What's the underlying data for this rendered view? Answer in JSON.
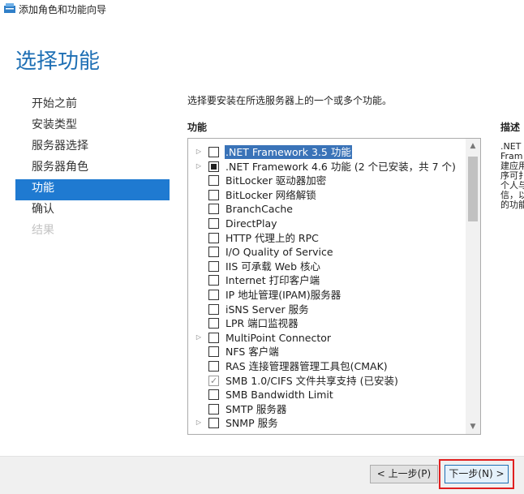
{
  "window": {
    "title": "添加角色和功能向导"
  },
  "page": {
    "title": "选择功能",
    "instruction": "选择要安装在所选服务器上的一个或多个功能。",
    "features_header": "功能",
    "description_header": "描述"
  },
  "steps": [
    {
      "label": "开始之前",
      "state": "normal"
    },
    {
      "label": "安装类型",
      "state": "normal"
    },
    {
      "label": "服务器选择",
      "state": "normal"
    },
    {
      "label": "服务器角色",
      "state": "normal"
    },
    {
      "label": "功能",
      "state": "active"
    },
    {
      "label": "确认",
      "state": "normal"
    },
    {
      "label": "结果",
      "state": "disabled"
    }
  ],
  "features": [
    {
      "label": ".NET Framework 3.5 功能",
      "expandable": true,
      "check": "none",
      "selected": true
    },
    {
      "label": ".NET Framework 4.6 功能 (2 个已安装，共 7 个)",
      "expandable": true,
      "check": "partial",
      "selected": false
    },
    {
      "label": "BitLocker 驱动器加密",
      "expandable": false,
      "check": "none",
      "selected": false
    },
    {
      "label": "BitLocker 网络解锁",
      "expandable": false,
      "check": "none",
      "selected": false
    },
    {
      "label": "BranchCache",
      "expandable": false,
      "check": "none",
      "selected": false
    },
    {
      "label": "DirectPlay",
      "expandable": false,
      "check": "none",
      "selected": false
    },
    {
      "label": "HTTP 代理上的 RPC",
      "expandable": false,
      "check": "none",
      "selected": false
    },
    {
      "label": "I/O Quality of Service",
      "expandable": false,
      "check": "none",
      "selected": false
    },
    {
      "label": "IIS 可承载 Web 核心",
      "expandable": false,
      "check": "none",
      "selected": false
    },
    {
      "label": "Internet 打印客户端",
      "expandable": false,
      "check": "none",
      "selected": false
    },
    {
      "label": "IP 地址管理(IPAM)服务器",
      "expandable": false,
      "check": "none",
      "selected": false
    },
    {
      "label": "iSNS Server 服务",
      "expandable": false,
      "check": "none",
      "selected": false
    },
    {
      "label": "LPR 端口监视器",
      "expandable": false,
      "check": "none",
      "selected": false
    },
    {
      "label": "MultiPoint Connector",
      "expandable": true,
      "check": "none",
      "selected": false
    },
    {
      "label": "NFS 客户端",
      "expandable": false,
      "check": "none",
      "selected": false
    },
    {
      "label": "RAS 连接管理器管理工具包(CMAK)",
      "expandable": false,
      "check": "none",
      "selected": false
    },
    {
      "label": "SMB 1.0/CIFS 文件共享支持 (已安装)",
      "expandable": false,
      "check": "checked",
      "selected": false
    },
    {
      "label": "SMB Bandwidth Limit",
      "expandable": false,
      "check": "none",
      "selected": false
    },
    {
      "label": "SMTP 服务器",
      "expandable": false,
      "check": "none",
      "selected": false
    },
    {
      "label": "SNMP 服务",
      "expandable": true,
      "check": "none",
      "selected": false
    }
  ],
  "description_lines": [
    ".NET",
    "Fram",
    "建应用",
    "序可扌",
    "个人与",
    "信，以",
    "的功能"
  ],
  "buttons": {
    "prev": "< 上一步(P)",
    "next": "下一步(N) >"
  },
  "colors": {
    "accent": "#1e6fb4",
    "active_step": "#1f7ad1",
    "selection": "#3a73b8",
    "highlight_box": "#e02020"
  }
}
